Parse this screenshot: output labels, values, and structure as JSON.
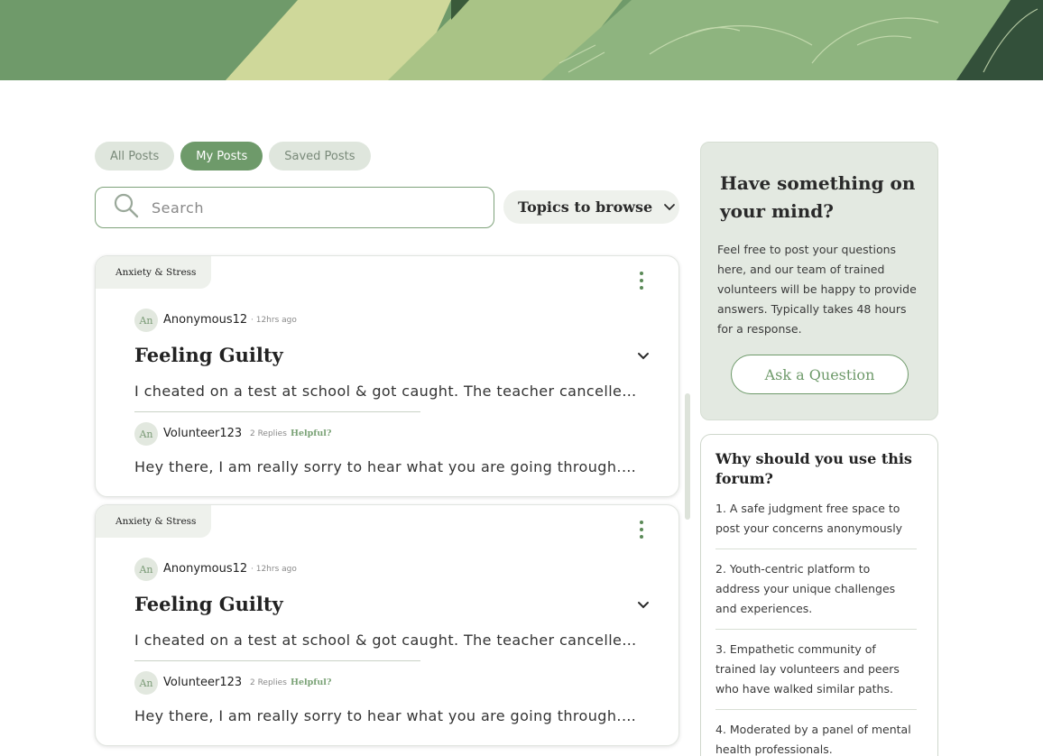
{
  "tabs": [
    {
      "label": "All Posts",
      "active": false
    },
    {
      "label": "My Posts",
      "active": true
    },
    {
      "label": "Saved Posts",
      "active": false
    }
  ],
  "search": {
    "placeholder": "Search"
  },
  "topics": {
    "label": "Topics to browse"
  },
  "posts": [
    {
      "tag": "Anxiety & Stress",
      "author": "Anonymous12",
      "author_initials": "An",
      "time": "· 12hrs ago",
      "title": "Feeling Guilty",
      "body": "I cheated on a test at school & got caught. The teacher cancelled my paper and informed my parents.",
      "reply": {
        "author": "Volunteer123",
        "author_initials": "An",
        "replies": "2 Replies",
        "helpful": "Helpful?",
        "body": "Hey there, I am really sorry to hear what you are going through. It is completely okay to feel this way."
      }
    },
    {
      "tag": "Anxiety & Stress",
      "author": "Anonymous12",
      "author_initials": "An",
      "time": "· 12hrs ago",
      "title": "Feeling Guilty",
      "body": "I cheated on a test at school & got caught. The teacher cancelled my paper and informed my parents.",
      "reply": {
        "author": "Volunteer123",
        "author_initials": "An",
        "replies": "2 Replies",
        "helpful": "Helpful?",
        "body": "Hey there, I am really sorry to hear what you are going through. It is completely okay to feel this way."
      }
    }
  ],
  "cta": {
    "heading": "Have something on your mind?",
    "text": "Feel free to post your questions here, and our team of trained volunteers will be happy to provide answers. Typically takes 48 hours for a response.",
    "button": "Ask a Question"
  },
  "why": {
    "heading": "Why should you use this forum?",
    "items": [
      "1. A safe judgment free space to post your concerns anonymously",
      "2. Youth-centric platform to address your unique challenges and experiences.",
      "3. Empathetic community of trained lay volunteers and peers who have walked similar paths.",
      "4. Moderated by a panel of mental health professionals."
    ]
  },
  "colors": {
    "accent": "#6e9a6a",
    "tint": "#e3e9e1"
  }
}
